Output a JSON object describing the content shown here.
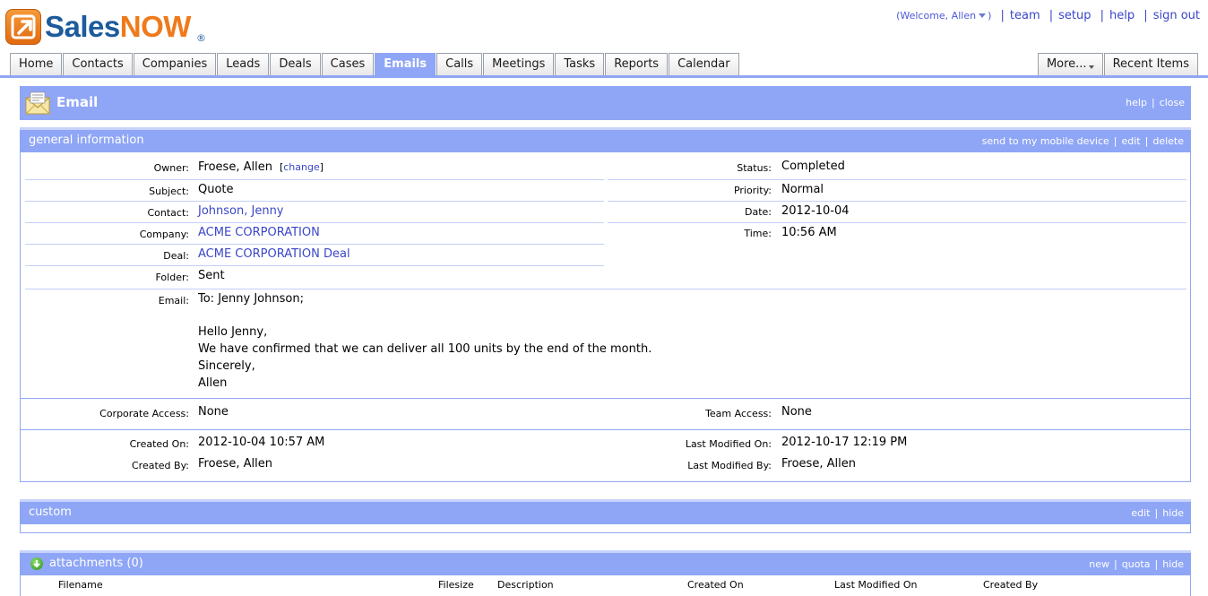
{
  "brand": {
    "sales": "Sales",
    "now": "NOW",
    "reg": "®"
  },
  "toplinks": {
    "welcome_open": "(Welcome, Allen",
    "welcome_close": ")",
    "items": [
      "team",
      "setup",
      "help",
      "sign out"
    ],
    "separator": "|"
  },
  "tabs": [
    "Home",
    "Contacts",
    "Companies",
    "Leads",
    "Deals",
    "Cases",
    "Emails",
    "Calls",
    "Meetings",
    "Tasks",
    "Reports",
    "Calendar"
  ],
  "active_tab": "Emails",
  "tabs_right": {
    "more": "More...",
    "recent": "Recent Items"
  },
  "titlebar": {
    "title": "Email",
    "help": "help",
    "close": "close"
  },
  "general": {
    "label": "general information",
    "links": [
      "send to my mobile device",
      "edit",
      "delete"
    ],
    "owner_label": "Owner:",
    "owner": "Froese, Allen",
    "change_open": "[",
    "change": "change",
    "change_close": "]",
    "subject_label": "Subject:",
    "subject": "Quote",
    "contact_label": "Contact:",
    "contact": "Johnson, Jenny",
    "company_label": "Company:",
    "company": "ACME CORPORATION",
    "deal_label": "Deal:",
    "deal": "ACME CORPORATION Deal",
    "folder_label": "Folder:",
    "folder": "Sent",
    "status_label": "Status:",
    "status": "Completed",
    "priority_label": "Priority:",
    "priority": "Normal",
    "date_label": "Date:",
    "date": "2012-10-04",
    "time_label": "Time:",
    "time": "10:56 AM",
    "email_label": "Email:",
    "email_to": "To: Jenny Johnson;",
    "email_lines": [
      "Hello Jenny,",
      "We have confirmed that we can deliver all 100 units by the end of the month.",
      "Sincerely,",
      "Allen"
    ],
    "corp_access_label": "Corporate Access:",
    "corp_access": "None",
    "team_access_label": "Team Access:",
    "team_access": "None",
    "created_on_label": "Created On:",
    "created_on": "2012-10-04 10:57 AM",
    "created_by_label": "Created By:",
    "created_by": "Froese, Allen",
    "modified_on_label": "Last Modified On:",
    "modified_on": "2012-10-17 12:19 PM",
    "modified_by_label": "Last Modified By:",
    "modified_by": "Froese, Allen"
  },
  "custom": {
    "label": "custom",
    "links": [
      "edit",
      "hide"
    ]
  },
  "attachments": {
    "label": "attachments (0)",
    "links": [
      "new",
      "quota",
      "hide"
    ],
    "columns": [
      "Filename",
      "Filesize",
      "Description",
      "Created On",
      "Last Modified On",
      "Created By"
    ]
  },
  "colors": {
    "accent": "#8fa6f6",
    "link": "#3a46c8",
    "brand_blue": "#1c5b9c",
    "brand_orange": "#ef7a1b"
  }
}
